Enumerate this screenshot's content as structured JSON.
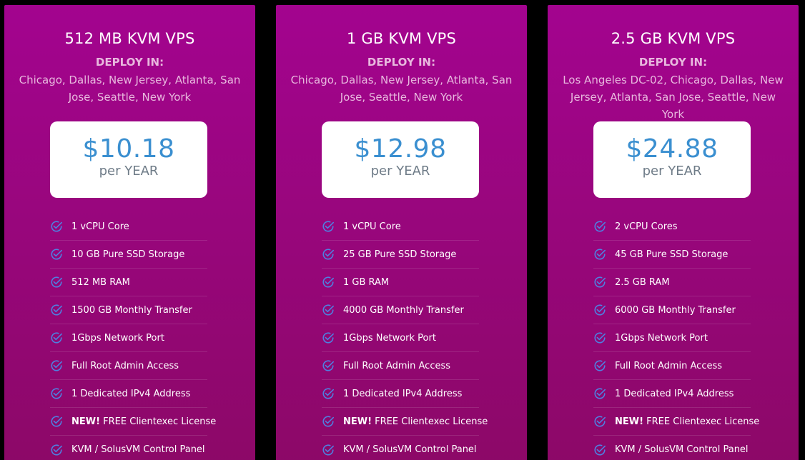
{
  "plans": [
    {
      "title": "512 MB KVM VPS",
      "deploy_label": "DEPLOY IN:",
      "locations": "Chicago, Dallas, New Jersey, Atlanta, San Jose, Seattle, New York",
      "price": "$10.18",
      "period": "per YEAR",
      "features": [
        "1 vCPU Core",
        "10 GB Pure SSD Storage",
        "512 MB RAM",
        "1500 GB Monthly Transfer",
        "1Gbps Network Port",
        "Full Root Admin Access",
        "1 Dedicated IPv4 Address",
        "FREE Clientexec License",
        "KVM / SolusVM Control Panel"
      ]
    },
    {
      "title": "1 GB KVM VPS",
      "deploy_label": "DEPLOY IN:",
      "locations": "Chicago, Dallas, New Jersey, Atlanta, San Jose, Seattle, New York",
      "price": "$12.98",
      "period": "per YEAR",
      "features": [
        "1 vCPU Core",
        "25 GB Pure SSD Storage",
        "1 GB RAM",
        "4000 GB Monthly Transfer",
        "1Gbps Network Port",
        "Full Root Admin Access",
        "1 Dedicated IPv4 Address",
        "FREE Clientexec License",
        "KVM / SolusVM Control Panel"
      ]
    },
    {
      "title": "2.5 GB KVM VPS",
      "deploy_label": "DEPLOY IN:",
      "locations": "Los Angeles DC-02, Chicago, Dallas, New Jersey, Atlanta, San Jose, Seattle, New York",
      "price": "$24.88",
      "period": "per YEAR",
      "features": [
        "2 vCPU Cores",
        "45 GB Pure SSD Storage",
        "2.5 GB RAM",
        "6000 GB Monthly Transfer",
        "1Gbps Network Port",
        "Full Root Admin Access",
        "1 Dedicated IPv4 Address",
        "FREE Clientexec License",
        "KVM / SolusVM Control Panel"
      ]
    }
  ],
  "new_badge": "NEW!",
  "icons": {
    "feature": "check-circle-icon"
  },
  "colors": {
    "card_top": "#a3048f",
    "card_bottom": "#8c0867",
    "price": "#3a8fd0",
    "check": "#4f7fe0"
  }
}
